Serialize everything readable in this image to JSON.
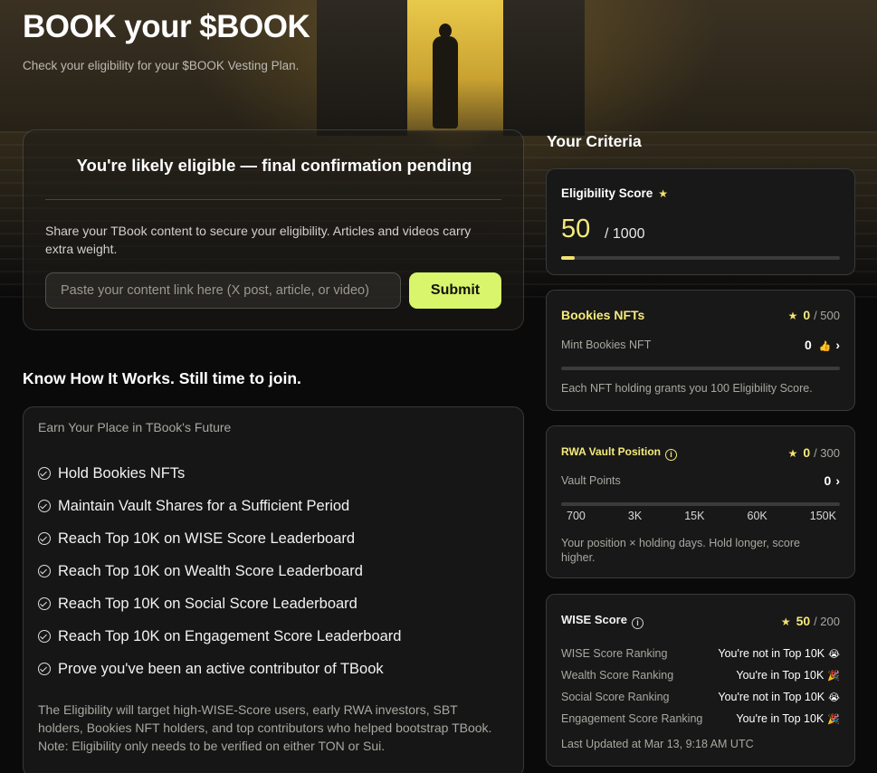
{
  "header": {
    "title": "BOOK your $BOOK",
    "subtitle": "Check your eligibility for your $BOOK Vesting Plan."
  },
  "eligibility": {
    "title": "You're likely eligible — final confirmation pending",
    "description": "Share your TBook content to secure your eligibility. Articles and videos carry extra weight.",
    "input_placeholder": "Paste your content link here (X post, article, or video)",
    "input_value": "",
    "submit_label": "Submit"
  },
  "how_it_works": {
    "heading": "Know How It Works. Still time to join.",
    "card_title": "Earn Your Place in TBook's Future",
    "items": [
      "Hold Bookies NFTs",
      "Maintain Vault Shares for a Sufficient Period",
      "Reach Top 10K on WISE Score Leaderboard",
      "Reach Top 10K on Wealth Score Leaderboard",
      "Reach Top 10K on Social Score Leaderboard",
      "Reach Top 10K on Engagement Score Leaderboard",
      "Prove you've been an active contributor of TBook"
    ],
    "note": "The Eligibility will target high-WISE-Score users, early RWA investors, SBT holders, Bookies NFT holders, and top contributors who helped bootstrap TBook.",
    "note2": "Note: Eligibility only needs to be verified on either TON or Sui."
  },
  "criteria": {
    "heading": "Your Criteria",
    "eligibility_score": {
      "label": "Eligibility Score",
      "value": "50",
      "max": "/ 1000",
      "progress": 0.05
    },
    "bookies": {
      "title": "Bookies NFTs",
      "points": "0",
      "points_max": "/ 500",
      "row_label": "Mint Bookies NFT",
      "row_value": "0",
      "progress": 0,
      "note": "Each NFT holding grants you 100 Eligibility Score."
    },
    "rwa": {
      "title": "RWA Vault Position",
      "points": "0",
      "points_max": "/ 300",
      "row_label": "Vault Points",
      "row_value": "0",
      "progress": 0,
      "ticks": [
        "700",
        "3K",
        "15K",
        "60K",
        "150K"
      ],
      "note": "Your position × holding days. Hold longer, score higher."
    },
    "wise": {
      "title": "WISE Score",
      "points": "50",
      "points_max": "/ 200",
      "rows": [
        {
          "label": "WISE Score Ranking",
          "value": "You're not in Top 10K",
          "emoji": "😭"
        },
        {
          "label": "Wealth Score Ranking",
          "value": "You're in Top 10K",
          "emoji": "🎉"
        },
        {
          "label": "Social Score Ranking",
          "value": "You're not in Top 10K",
          "emoji": "😭"
        },
        {
          "label": "Engagement Score Ranking",
          "value": "You're in Top 10K",
          "emoji": "🎉"
        }
      ],
      "updated": "Last Updated at Mar 13, 9:18 AM UTC"
    }
  },
  "colors": {
    "accent": "#d8f56b",
    "score_yellow": "#f5ea7b",
    "background": "#0a0a0a",
    "card_bg": "#181818"
  }
}
